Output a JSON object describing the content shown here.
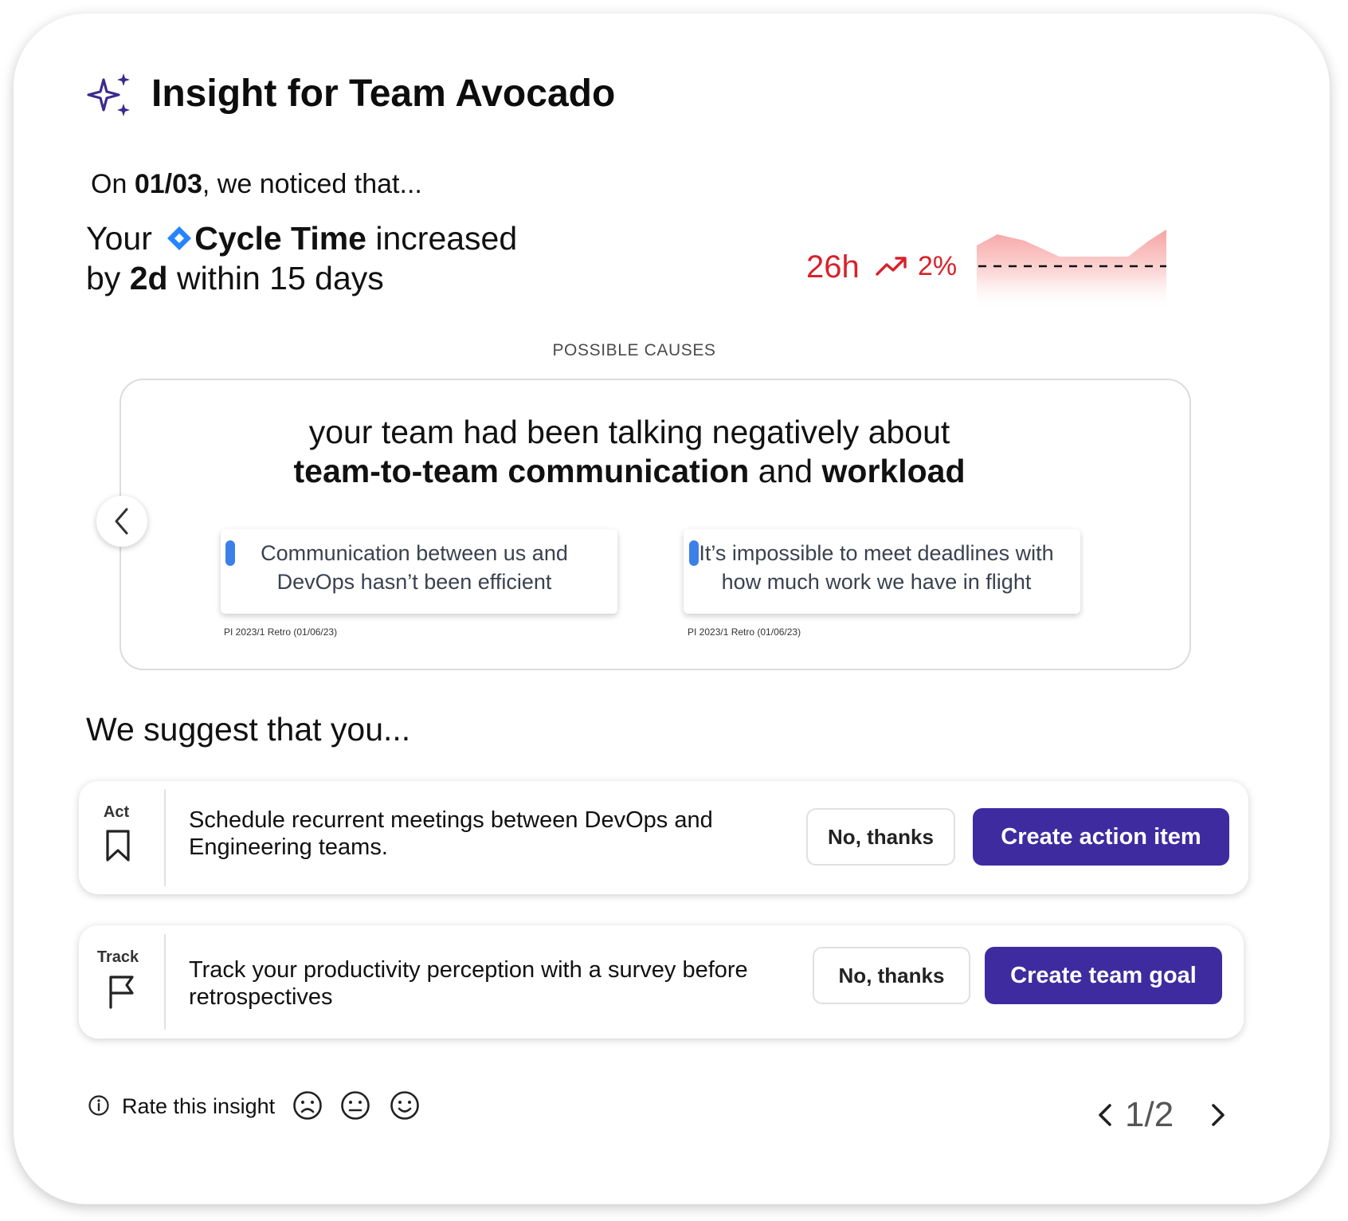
{
  "header": {
    "title": "Insight for Team Avocado"
  },
  "observation": {
    "prefix": "On ",
    "date": "01/03",
    "suffix": ", we noticed that...",
    "line1_prefix": "Your ",
    "metric_name": "Cycle Time",
    "line1_suffix": " increased",
    "line2_prefix": "by ",
    "change": "2d",
    "line2_suffix": " within 15 days"
  },
  "metric": {
    "value": "26h",
    "change_pct": "2%",
    "color": "#d8222b",
    "trend_icon": "trending-up-icon"
  },
  "causes": {
    "label": "POSSIBLE CAUSES",
    "text_prefix": "your team had been talking negatively about",
    "topic1": "team-to-team communication",
    "connector": " and ",
    "topic2": "workload",
    "quotes": [
      {
        "text": "Communication between us and DevOps hasn’t been efficient",
        "source": "PI 2023/1 Retro (01/06/23)"
      },
      {
        "text": "It’s impossible to meet deadlines with how much work we have in flight",
        "source": "PI 2023/1 Retro (01/06/23)"
      }
    ]
  },
  "suggestions": {
    "heading": "We suggest that you...",
    "items": [
      {
        "kind": "Act",
        "icon": "bookmark-icon",
        "text": "Schedule recurrent meetings between DevOps and Engineering teams.",
        "secondary_label": "No, thanks",
        "primary_label": "Create action item"
      },
      {
        "kind": "Track",
        "icon": "flag-icon",
        "text": "Track your productivity perception with a survey before retrospectives",
        "secondary_label": "No, thanks",
        "primary_label": "Create team goal"
      }
    ]
  },
  "footer": {
    "rate_label": "Rate this insight",
    "faces": [
      "sad-face-icon",
      "neutral-face-icon",
      "happy-face-icon"
    ],
    "pager": "1/2"
  },
  "colors": {
    "accent": "#3f2ba0",
    "metric_red": "#d8222b",
    "quote_bar": "#3d7fe8",
    "jira_blue": "#2684ff"
  }
}
